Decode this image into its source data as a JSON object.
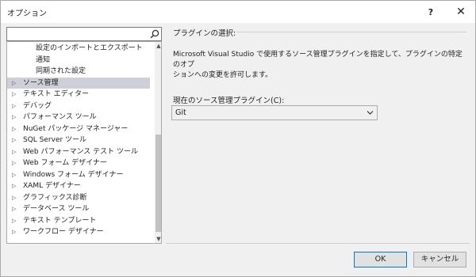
{
  "window": {
    "title": "オプション",
    "help_glyph": "?",
    "close_glyph": "✕"
  },
  "search": {
    "placeholder": ""
  },
  "tree": {
    "items": [
      {
        "label": "設定のインポートとエクスポート",
        "child": true,
        "expander": ""
      },
      {
        "label": "通知",
        "child": true,
        "expander": ""
      },
      {
        "label": "同期された設定",
        "child": true,
        "expander": ""
      },
      {
        "label": "ソース管理",
        "child": false,
        "expander": "▷",
        "selected": true
      },
      {
        "label": "テキスト エディター",
        "child": false,
        "expander": "▷"
      },
      {
        "label": "デバッグ",
        "child": false,
        "expander": "▷"
      },
      {
        "label": "パフォーマンス ツール",
        "child": false,
        "expander": "▷"
      },
      {
        "label": "NuGet パッケージ マネージャー",
        "child": false,
        "expander": "▷"
      },
      {
        "label": "SQL Server ツール",
        "child": false,
        "expander": "▷"
      },
      {
        "label": "Web パフォーマンス テスト ツール",
        "child": false,
        "expander": "▷"
      },
      {
        "label": "Web フォーム デザイナー",
        "child": false,
        "expander": "▷"
      },
      {
        "label": "Windows フォーム デザイナー",
        "child": false,
        "expander": "▷"
      },
      {
        "label": "XAML デザイナー",
        "child": false,
        "expander": "▷"
      },
      {
        "label": "グラフィックス診断",
        "child": false,
        "expander": "▷"
      },
      {
        "label": "データベース ツール",
        "child": false,
        "expander": "▷"
      },
      {
        "label": "テキスト テンプレート",
        "child": false,
        "expander": "▷"
      },
      {
        "label": "ワークフロー デザイナー",
        "child": false,
        "expander": "▷"
      }
    ]
  },
  "panel": {
    "section_title": "プラグインの選択:",
    "description_line1": "Microsoft Visual Studio で使用するソース管理プラグインを指定して、プラグインの特定のオプ",
    "description_line2": "ションへの変更を許可します。",
    "combo_label": "現在のソース管理プラグイン(C):",
    "combo_value": "Git"
  },
  "buttons": {
    "ok": "OK",
    "cancel": "キャンセル"
  },
  "colors": {
    "selected_row": "#cfcfd9",
    "accent": "#0078d7"
  }
}
